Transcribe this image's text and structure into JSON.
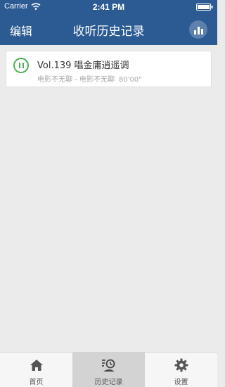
{
  "status_bar": {
    "carrier": "Carrier",
    "time": "2:41 PM"
  },
  "nav": {
    "edit_label": "编辑",
    "title": "收听历史记录"
  },
  "history": [
    {
      "title": "Vol.139 唱金庸逍遥调",
      "subtitle": "电影不无聊 - 电影不无聊",
      "duration": "80'00\""
    }
  ],
  "tabs": [
    {
      "label": "首页",
      "icon": "home-icon",
      "active": false
    },
    {
      "label": "历史记录",
      "icon": "history-icon",
      "active": true
    },
    {
      "label": "设置",
      "icon": "gear-icon",
      "active": false
    }
  ],
  "colors": {
    "nav_bg": "#2c5a93",
    "play_green": "#4caf50",
    "page_bg": "#ebebeb"
  }
}
